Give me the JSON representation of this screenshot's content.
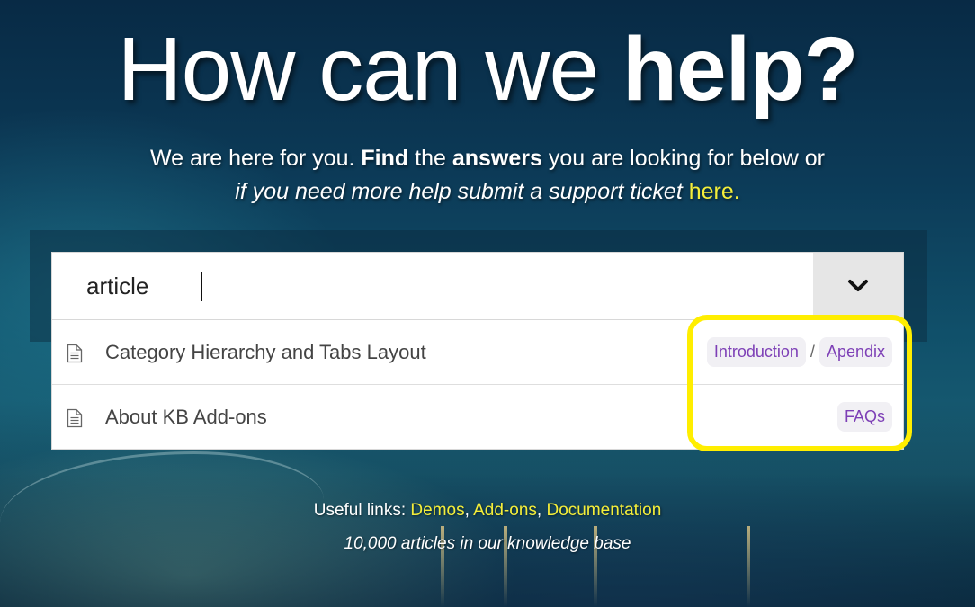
{
  "hero": {
    "title_regular": "How can we ",
    "title_bold": "help?"
  },
  "subtitle": {
    "part1": "We are here for you. ",
    "find": "Find",
    "part2": " the ",
    "answers": "answers",
    "part3": " you are looking for below or",
    "line2_italic": "if you need more help submit a support ticket ",
    "link": "here."
  },
  "search": {
    "value": "article",
    "dropdown_icon": "chevron-down-icon"
  },
  "results": [
    {
      "title": "Category Hierarchy and Tabs Layout",
      "icon": "document-icon",
      "tags": [
        "Introduction",
        "Apendix"
      ],
      "separator": "/"
    },
    {
      "title": "About KB Add-ons",
      "icon": "document-icon",
      "tags": [
        "FAQs"
      ]
    }
  ],
  "footer": {
    "useful_label": "Useful links: ",
    "links": [
      "Demos",
      "Add-ons",
      "Documentation"
    ],
    "comma": ", ",
    "count_text": "10,000 articles in our knowledge base"
  },
  "colors": {
    "accent_link": "#f4ee3a",
    "tag_text": "#7d3fb6",
    "highlight": "#ffee00"
  }
}
